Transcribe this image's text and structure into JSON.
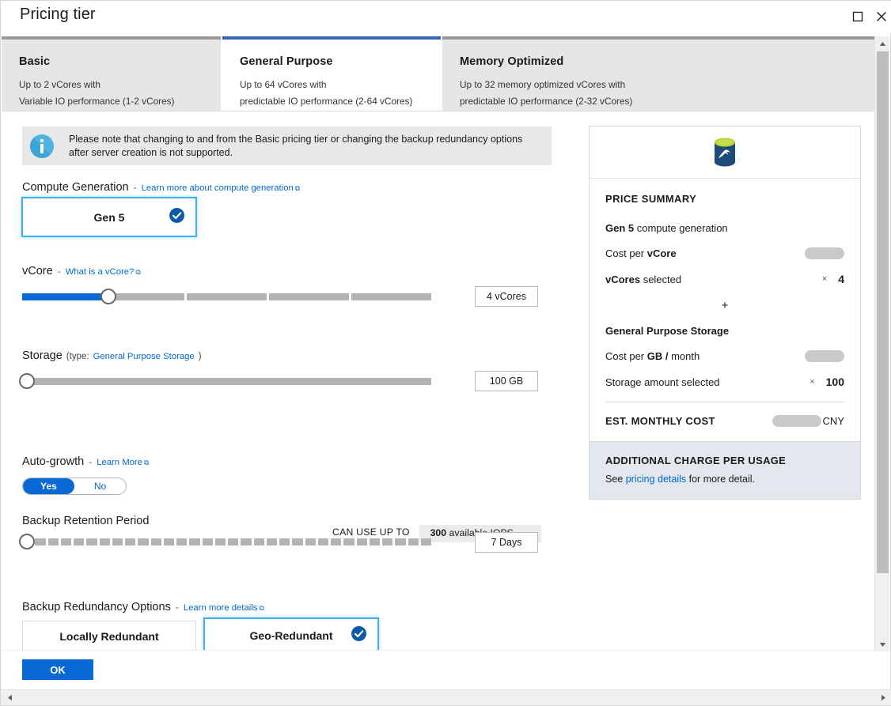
{
  "window": {
    "title": "Pricing tier",
    "maximize_icon": "maximize-icon",
    "close_icon": "close-icon"
  },
  "tabs": [
    {
      "title": "Basic",
      "line1": "Up to 2 vCores with",
      "line2": "Variable IO performance (1-2 vCores)",
      "selected": false
    },
    {
      "title": "General Purpose",
      "line1": "Up to 64 vCores with",
      "line2": "predictable IO performance (2-64 vCores)",
      "selected": true
    },
    {
      "title": "Memory Optimized",
      "line1": "Up to 32 memory optimized vCores with",
      "line2": "predictable IO performance (2-32 vCores)",
      "selected": false
    }
  ],
  "info_banner": {
    "icon": "info-icon",
    "text": "Please note that changing to and from the Basic pricing tier or changing the backup redundancy options after server creation is not supported."
  },
  "compute_generation": {
    "label": "Compute Generation",
    "dash": "-",
    "link": "Learn more about compute generation",
    "option_label": "Gen 5",
    "selected": true
  },
  "vcore": {
    "label": "vCore",
    "dash": "-",
    "link": "What is a vCore?",
    "value_text": "4 vCores",
    "value": 4,
    "segments": 5,
    "fill_percent": 20,
    "thumb_percent": 20
  },
  "storage": {
    "label": "Storage",
    "type_prefix": "(type:",
    "type_link": "General Purpose Storage",
    "type_suffix": ")",
    "value_text": "100 GB",
    "value": 100,
    "fill_percent": 0,
    "thumb_percent": 0
  },
  "iops": {
    "caption": "CAN USE UP TO",
    "amount": "300",
    "unit": "available IOPS"
  },
  "auto_growth": {
    "label": "Auto-growth",
    "dash": "-",
    "link": "Learn More",
    "options": [
      "Yes",
      "No"
    ],
    "selected": "Yes"
  },
  "backup_retention": {
    "label": "Backup Retention Period",
    "value_text": "7 Days",
    "value": 7,
    "segments": 32,
    "fill_percent": 0,
    "thumb_percent": 0
  },
  "backup_redundancy": {
    "label": "Backup Redundancy Options",
    "dash": "-",
    "link": "Learn more details",
    "options": [
      {
        "label": "Locally Redundant",
        "selected": false
      },
      {
        "label": "Geo-Redundant",
        "selected": true
      }
    ]
  },
  "price_summary": {
    "logo_icon": "mysql-database-icon",
    "title": "PRICE SUMMARY",
    "rows": [
      {
        "name": "generation",
        "label_bold": "Gen 5",
        "label_rest": " compute generation",
        "value_type": "none"
      },
      {
        "name": "cost-per-vcore",
        "label_bold": "",
        "label_rest": "Cost per ",
        "label_bold_end": "vCore",
        "value_type": "redacted",
        "redacted_width": 50
      },
      {
        "name": "vcores-selected",
        "label_bold": "vCores",
        "label_rest": " selected",
        "value_type": "number",
        "operator": "×",
        "value": "4"
      }
    ],
    "plus": "+",
    "storage_rows": [
      {
        "name": "storage-type",
        "label_bold": "General Purpose Storage",
        "label_rest": "",
        "value_type": "none"
      },
      {
        "name": "cost-per-gb",
        "label_rest": "Cost per ",
        "label_bold_end": "GB /",
        "label_tail": " month",
        "value_type": "redacted",
        "redacted_width": 50
      },
      {
        "name": "storage-amount",
        "label_rest": "Storage amount selected",
        "value_type": "number",
        "operator": "×",
        "value": "100"
      }
    ],
    "estimate": {
      "label": "EST. MONTHLY COST",
      "value_redacted": true,
      "redacted_width": 62,
      "currency": "CNY"
    },
    "footer": {
      "title": "ADDITIONAL CHARGE PER USAGE",
      "text_before": "See ",
      "link": "pricing details",
      "text_after": " for more detail."
    }
  },
  "footer": {
    "ok_label": "OK"
  },
  "colors": {
    "accent": "#0868d4",
    "tab_selected_border": "#3465b0",
    "link": "#0069c8",
    "selected_card_border": "#41b0f0",
    "track": "#b3b3b3",
    "info_icon": "#4eb3e0",
    "summary_footer_bg": "#e3e7ee",
    "db_green": "#b8d432",
    "db_blue": "#1e4b7b"
  }
}
